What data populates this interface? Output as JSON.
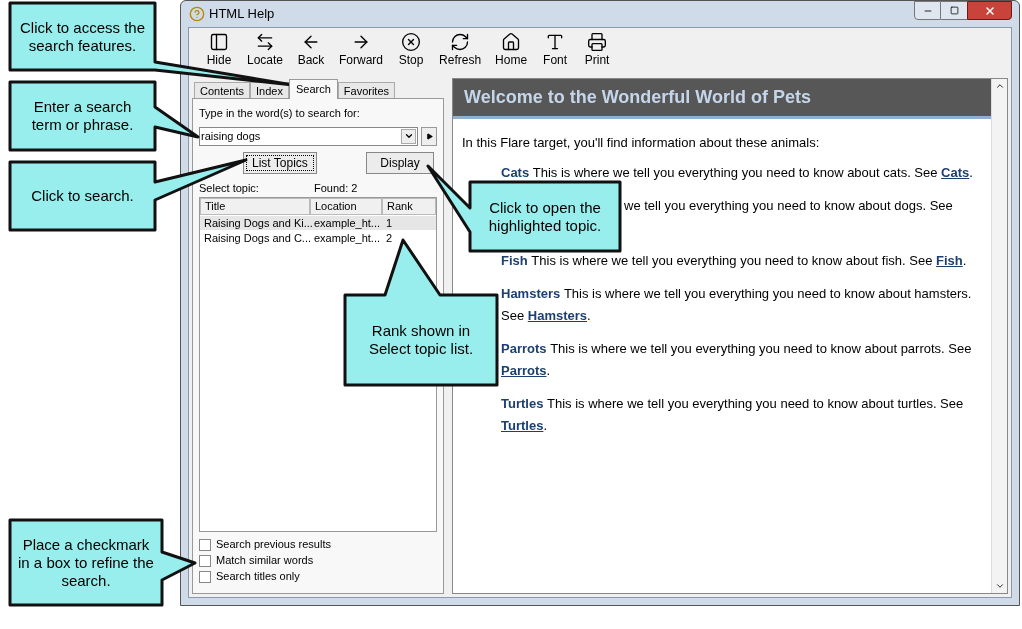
{
  "window": {
    "title": "HTML Help"
  },
  "toolbar": [
    {
      "label": "Hide"
    },
    {
      "label": "Locate"
    },
    {
      "label": "Back"
    },
    {
      "label": "Forward"
    },
    {
      "label": "Stop"
    },
    {
      "label": "Refresh"
    },
    {
      "label": "Home"
    },
    {
      "label": "Font"
    },
    {
      "label": "Print"
    }
  ],
  "tabs": [
    {
      "label": "Contents",
      "selected": false
    },
    {
      "label": "Index",
      "selected": false
    },
    {
      "label": "Search",
      "selected": true
    },
    {
      "label": "Favorites",
      "selected": false
    }
  ],
  "search_panel": {
    "prompt": "Type in the word(s) to search for:",
    "query": "raising dogs",
    "buttons": [
      "List Topics",
      "Display"
    ],
    "select_label": "Select topic:",
    "found": "Found: 2",
    "columns": [
      "Title",
      "Location",
      "Rank"
    ],
    "rows": [
      {
        "cells": [
          "Raising Dogs and Ki...",
          "example_ht...",
          "1"
        ],
        "selected": true
      },
      {
        "cells": [
          "Raising Dogs and C...",
          "example_ht...",
          "2"
        ],
        "selected": false
      }
    ],
    "options": [
      {
        "label": "Search previous results",
        "checked": false
      },
      {
        "label": "Match similar words",
        "checked": false
      },
      {
        "label": "Search titles only",
        "checked": false
      }
    ]
  },
  "content": {
    "heading": "Welcome to the Wonderful World of Pets",
    "intro": "In this Flare target, you'll find information about these animals:",
    "animals": [
      {
        "name": "Cats",
        "text": "This is where we tell you everything you need to know about cats. See",
        "link": "Cats",
        "end": "."
      },
      {
        "text": "we tell you everything you need to know about dogs. See"
      },
      {
        "name": "Fish",
        "text": "This is where we tell you everything you need to know about fish. See",
        "link": "Fish",
        "end": "."
      },
      {
        "name": "Hamsters",
        "text": "This is where we tell you everything you need to know about hamsters. See",
        "link": "Hamsters",
        "end": "."
      },
      {
        "name": "Parrots",
        "text": "This is where we tell you everything you need to know about parrots. See",
        "link": "Parrots",
        "end": "."
      },
      {
        "name": "Turtles",
        "text": "This is where we tell you everything you need to know about turtles. See",
        "link": "Turtles",
        "end": "."
      }
    ]
  },
  "callouts": [
    {
      "text": "Click to access the search features."
    },
    {
      "text": "Enter a search term or phrase."
    },
    {
      "text": "Click to search."
    },
    {
      "text": "Place a checkmark in a box to refine the search."
    },
    {
      "text": "Click to open the highlighted topic."
    },
    {
      "text": "Rank shown in Select topic list."
    }
  ]
}
